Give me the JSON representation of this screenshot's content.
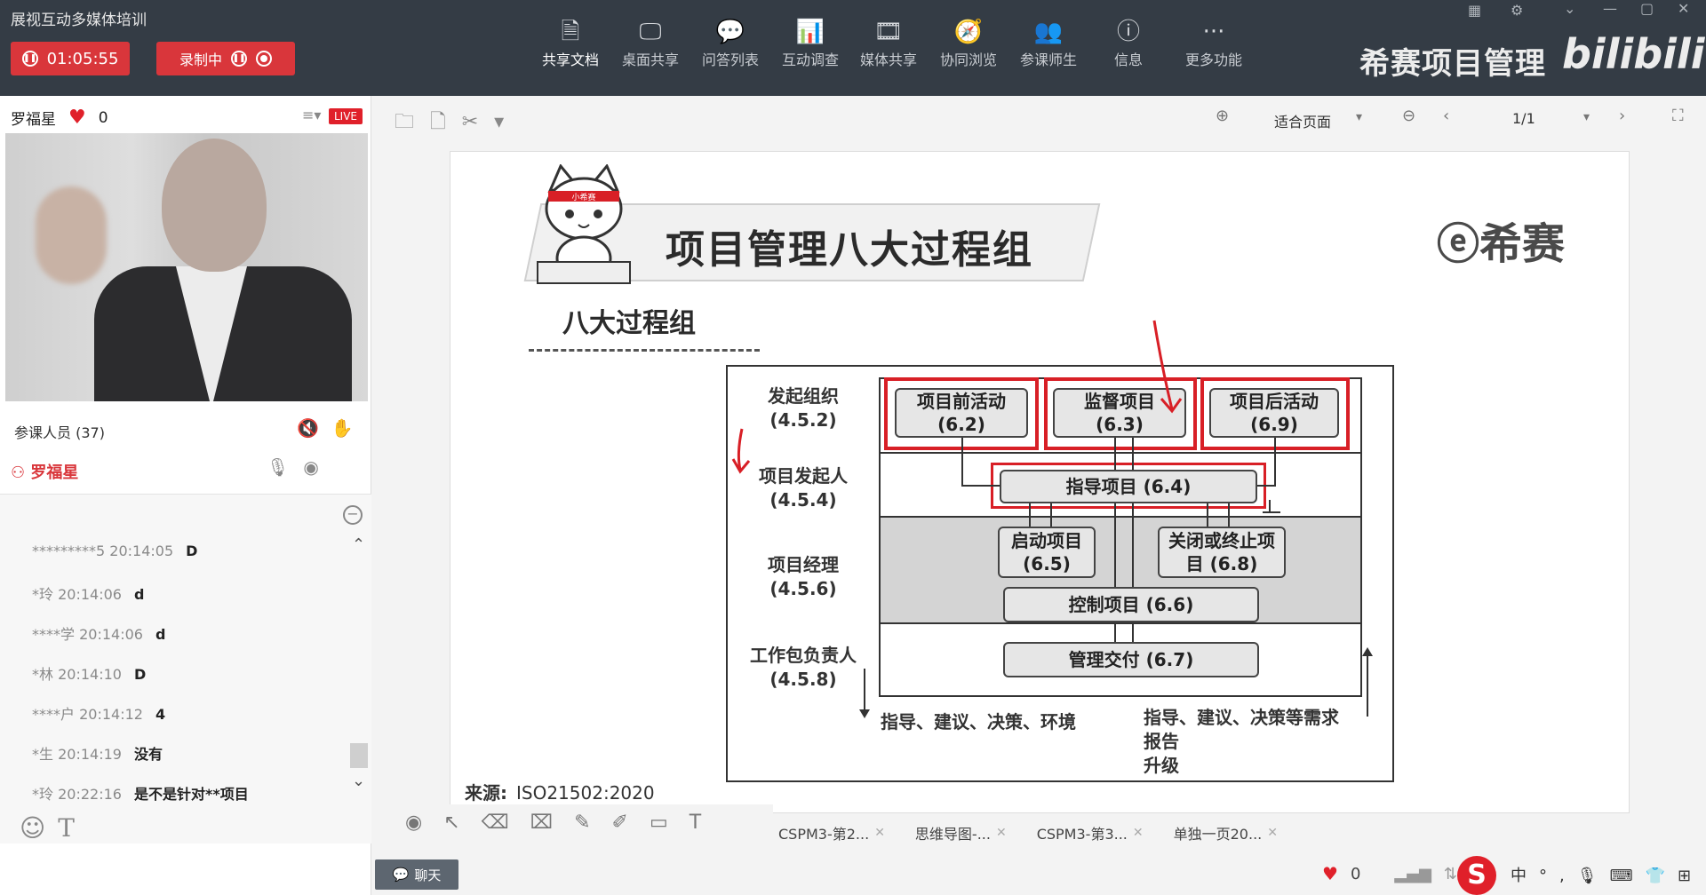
{
  "app": {
    "title": "展视互动多媒体培训"
  },
  "header": {
    "timer": "01:05:55",
    "recording_label": "录制中",
    "tools": [
      {
        "label": "共享文档",
        "icon": "document-icon",
        "glyph": "🗎"
      },
      {
        "label": "桌面共享",
        "icon": "desktop-share-icon",
        "glyph": "🖵"
      },
      {
        "label": "问答列表",
        "icon": "qa-icon",
        "glyph": "💬"
      },
      {
        "label": "互动调查",
        "icon": "survey-chart-icon",
        "glyph": "📊"
      },
      {
        "label": "媒体共享",
        "icon": "media-icon",
        "glyph": "🎞"
      },
      {
        "label": "协同浏览",
        "icon": "browse-compass-icon",
        "glyph": "🧭"
      },
      {
        "label": "参课师生",
        "icon": "people-icon",
        "glyph": "👥"
      },
      {
        "label": "信息",
        "icon": "info-icon",
        "glyph": "ⓘ"
      },
      {
        "label": "更多功能",
        "icon": "more-icon",
        "glyph": "···"
      }
    ],
    "brand": "希赛项目管理",
    "bili_logo": "bilibili"
  },
  "left": {
    "host_name": "罗福星",
    "likes": "0",
    "live_badge": "LIVE",
    "attendees_label": "参课人员 (37)",
    "host_line": "罗福星",
    "chat": [
      {
        "user": "*********5",
        "time": "20:14:05",
        "msg": "D"
      },
      {
        "user": "*玲",
        "time": "20:14:06",
        "msg": "d"
      },
      {
        "user": "****学",
        "time": "20:14:06",
        "msg": "d"
      },
      {
        "user": "*林",
        "time": "20:14:10",
        "msg": "D"
      },
      {
        "user": "****户",
        "time": "20:14:12",
        "msg": "4"
      },
      {
        "user": "*生",
        "time": "20:14:19",
        "msg": "没有"
      },
      {
        "user": "*玲",
        "time": "20:22:16",
        "msg": "是不是针对**项目"
      }
    ]
  },
  "doc_toolbar": {
    "fit_label": "适合页面",
    "page": "1/1"
  },
  "slide": {
    "mascot_label": "小希赛",
    "title": "项目管理八大过程组",
    "subtitle": "八大过程组",
    "logo": "希赛",
    "roles": [
      {
        "name": "发起组织",
        "code": "(4.5.2)"
      },
      {
        "name": "项目发起人",
        "code": "(4.5.4)"
      },
      {
        "name": "项目经理",
        "code": "(4.5.6)"
      },
      {
        "name": "工作包负责人",
        "code": "(4.5.8)"
      }
    ],
    "processes": {
      "pre": {
        "name": "项目前活动",
        "code": "(6.2)"
      },
      "monitor": {
        "name": "监督项目",
        "code": "(6.3)"
      },
      "post": {
        "name": "项目后活动",
        "code": "(6.9)"
      },
      "direct": {
        "name": "指导项目",
        "code": "(6.4)"
      },
      "initiate": {
        "name": "启动项目",
        "code": "(6.5)"
      },
      "close_line1": "关闭或终止项",
      "close_line2": "目 (6.8)",
      "control": {
        "name": "控制项目",
        "code": "(6.6)"
      },
      "deliver": {
        "name": "管理交付",
        "code": "(6.7)"
      }
    },
    "footer_left": "指导、建议、决策、环境",
    "footer_right": [
      "指导、建议、决策等需求",
      "报告",
      "升级"
    ],
    "source_label": "来源:",
    "source_value": "ISO21502:2020"
  },
  "tabs": [
    {
      "label": "CSPM3-第2..."
    },
    {
      "label": "思维导图-..."
    },
    {
      "label": "CSPM3-第3..."
    },
    {
      "label": "单独一页20..."
    }
  ],
  "bottom": {
    "chat_button": "聊天",
    "likes": "0",
    "ime": "中"
  }
}
